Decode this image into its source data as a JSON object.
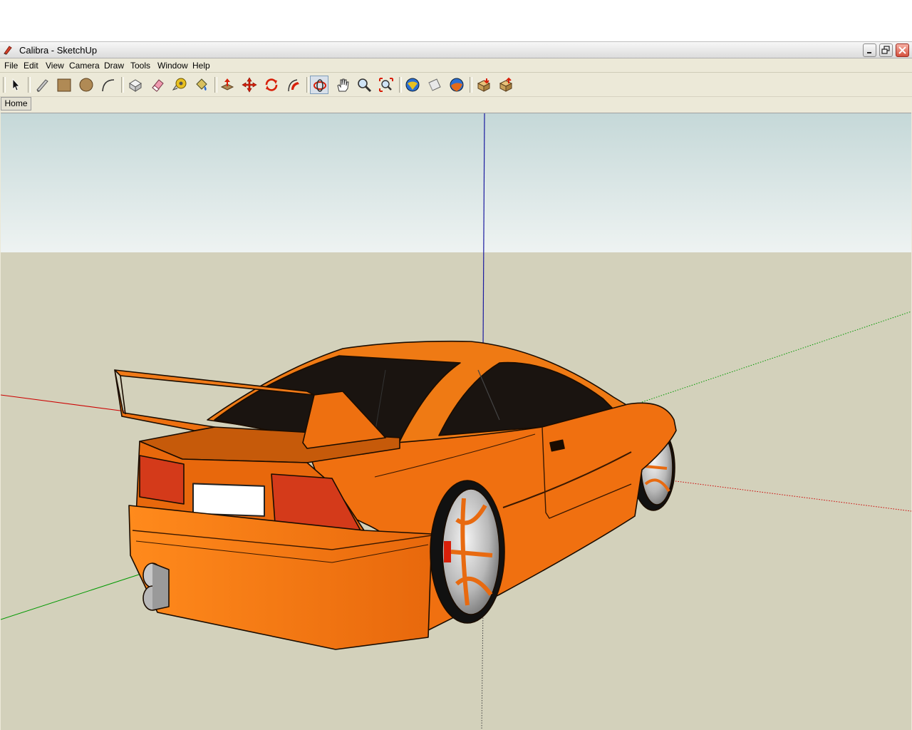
{
  "window": {
    "title": "Calibra - SketchUp"
  },
  "menu": {
    "items": [
      "File",
      "Edit",
      "View",
      "Camera",
      "Draw",
      "Tools",
      "Window",
      "Help"
    ]
  },
  "toolbar": {
    "tools": [
      {
        "icon": "select-icon",
        "active": false
      },
      {
        "icon": "pencil-line-icon",
        "active": false
      },
      {
        "icon": "rectangle-icon",
        "active": false
      },
      {
        "icon": "circle-icon",
        "active": false
      },
      {
        "icon": "arc-icon",
        "active": false
      },
      {
        "icon": "make-component-icon",
        "active": false
      },
      {
        "icon": "eraser-icon",
        "active": false
      },
      {
        "icon": "tape-measure-icon",
        "active": false
      },
      {
        "icon": "paint-bucket-icon",
        "active": false
      },
      {
        "icon": "push-pull-icon",
        "active": false
      },
      {
        "icon": "move-icon",
        "active": false
      },
      {
        "icon": "rotate-icon",
        "active": false
      },
      {
        "icon": "follow-me-icon",
        "active": false
      },
      {
        "icon": "orbit-icon",
        "active": true
      },
      {
        "icon": "pan-icon",
        "active": false
      },
      {
        "icon": "zoom-icon",
        "active": false
      },
      {
        "icon": "zoom-extents-icon",
        "active": false
      },
      {
        "icon": "get-models-icon",
        "active": false
      },
      {
        "icon": "share-model-icon",
        "active": false
      },
      {
        "icon": "google-earth-icon",
        "active": false
      },
      {
        "icon": "get-components-icon",
        "active": false
      },
      {
        "icon": "share-component-icon",
        "active": false
      }
    ]
  },
  "scene_tabs": {
    "items": [
      "Home"
    ]
  },
  "viewport": {
    "sky_color": "#cfe0e0",
    "ground_color": "#d3d1bb",
    "model_color": "#f07010",
    "axis_colors": {
      "red": "#cc0000",
      "green": "#009900",
      "blue": "#0000aa"
    },
    "license_plate": ""
  }
}
